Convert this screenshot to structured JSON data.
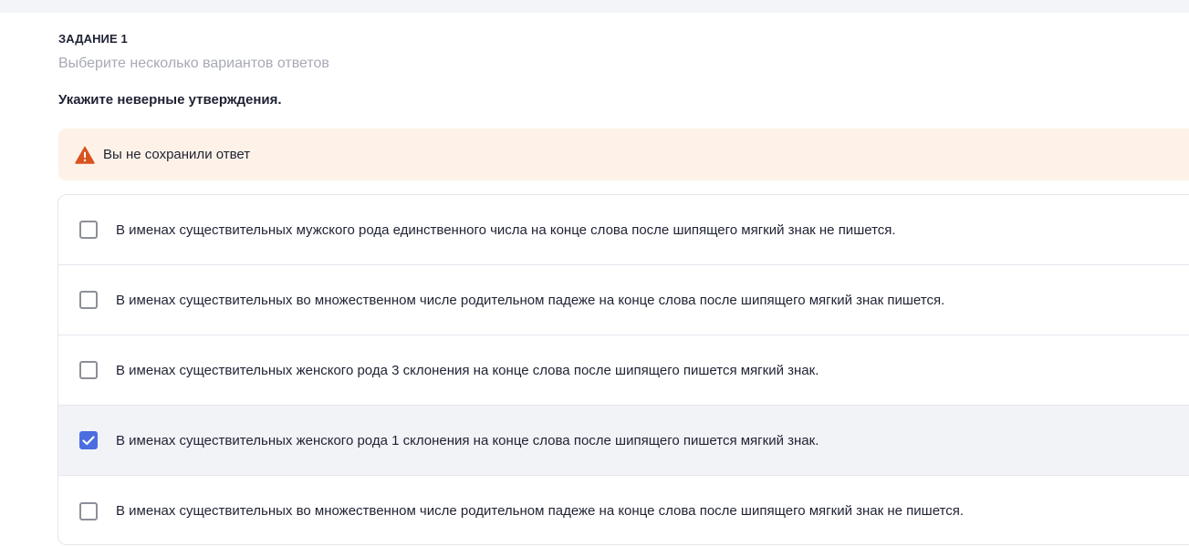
{
  "task": {
    "label": "ЗАДАНИЕ 1",
    "hint": "Выберите несколько вариантов ответов",
    "question": "Укажите неверные утверждения."
  },
  "alert": {
    "icon": "warning-icon",
    "text": "Вы не сохранили ответ",
    "color": "#d9531e",
    "background": "#fef2e8"
  },
  "accent": "#4a6ee0",
  "options": [
    {
      "text": "В именах существительных мужского рода единственного числа на конце слова после шипящего мягкий знак не пишется.",
      "checked": false
    },
    {
      "text": "В именах существительных во множественном числе родительном падеже на конце слова после шипящего мягкий знак пишется.",
      "checked": false
    },
    {
      "text": "В именах существительных женского рода 3 склонения на конце слова после шипящего пишется мягкий знак.",
      "checked": false
    },
    {
      "text": "В именах существительных женского рода 1 склонения на конце слова после шипящего пишется мягкий знак.",
      "checked": true
    },
    {
      "text": "В именах существительных во множественном числе родительном падеже на конце слова после шипящего мягкий знак не пишется.",
      "checked": false
    }
  ]
}
